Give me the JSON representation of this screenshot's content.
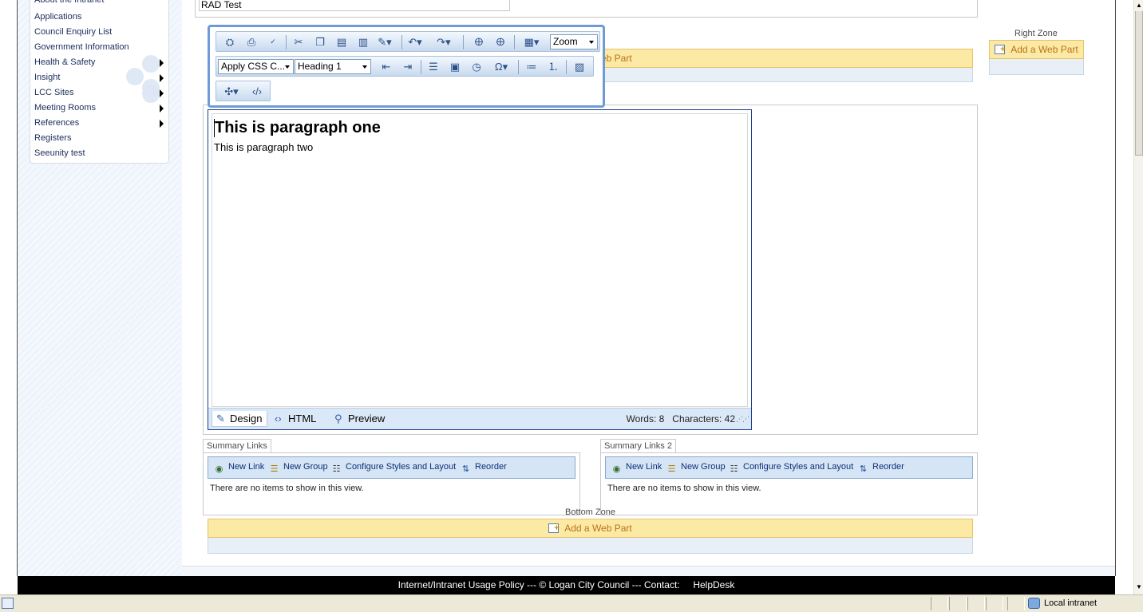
{
  "quick_launch": {
    "items": [
      {
        "label": "About the Intranet",
        "has_submenu": false
      },
      {
        "label": "Applications",
        "has_submenu": false
      },
      {
        "label": "Council Enquiry List",
        "has_submenu": false
      },
      {
        "label": "Government Information",
        "has_submenu": false
      },
      {
        "label": "Health & Safety",
        "has_submenu": true
      },
      {
        "label": "Insight",
        "has_submenu": true
      },
      {
        "label": "LCC Sites",
        "has_submenu": true
      },
      {
        "label": "Meeting Rooms",
        "has_submenu": true
      },
      {
        "label": "References",
        "has_submenu": true
      },
      {
        "label": "Registers",
        "has_submenu": false
      },
      {
        "label": "Seeunity test",
        "has_submenu": false
      }
    ]
  },
  "page_title_field": {
    "value": "RAD Test"
  },
  "top_zone": {
    "add_label": "Add a Web Part",
    "visible_fragment": "eb Part"
  },
  "right_zone": {
    "label": "Right Zone",
    "add_label": "Add a Web Part"
  },
  "bottom_zone": {
    "label": "Bottom Zone",
    "add_label": "Add a Web Part"
  },
  "rte_toolbar": {
    "zoom_select": "Zoom",
    "css_class_select": "Apply CSS C...",
    "style_select": "Heading 1",
    "icons": [
      "find-icon",
      "print-icon",
      "spellcheck-icon",
      "cut-icon",
      "copy-icon",
      "paste-icon",
      "paste-text-icon",
      "format-stripper-icon",
      "undo-icon",
      "redo-icon",
      "hyperlink-icon",
      "remove-link-icon",
      "table-icon",
      "outdent-icon",
      "indent-icon",
      "align-left-icon",
      "template-icon",
      "datetime-icon",
      "symbol-icon",
      "bullet-list-icon",
      "numbered-list-icon",
      "image-icon",
      "module-icon",
      "html-snippet-icon"
    ]
  },
  "editor": {
    "heading": "This is paragraph one",
    "paragraph": "This is paragraph two",
    "tabs": {
      "design": "Design",
      "html": "HTML",
      "preview": "Preview"
    },
    "words_label": "Words: 8",
    "chars_label": "Characters: 42"
  },
  "summary_links": [
    {
      "title": "Summary Links",
      "actions": [
        "New Link",
        "New Group",
        "Configure Styles and Layout",
        "Reorder"
      ],
      "empty_text": "There are no items to show in this view."
    },
    {
      "title": "Summary Links 2",
      "actions": [
        "New Link",
        "New Group",
        "Configure Styles and Layout",
        "Reorder"
      ],
      "empty_text": "There are no items to show in this view."
    }
  ],
  "footer": {
    "text": "Internet/Intranet Usage Policy --- © Logan City Council --- Contact:",
    "helpdesk": "HelpDesk"
  },
  "statusbar": {
    "zone": "Local intranet"
  },
  "colors": {
    "accent": "#6e9bd6",
    "add_webpart_bg": "#fce9a4",
    "add_webpart_text": "#b8731a",
    "footer_bg": "#000000"
  }
}
